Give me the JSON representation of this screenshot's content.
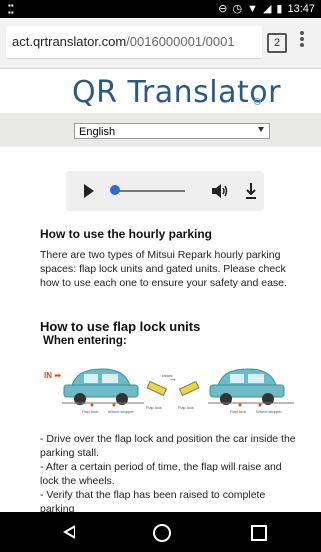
{
  "status_bar": {
    "time": "13:47",
    "left_icon": "notification-icon",
    "icons": [
      "minus-circle-icon",
      "alarm-icon",
      "wifi-icon",
      "signal-icon",
      "battery-icon"
    ]
  },
  "browser": {
    "url_domain": "act.qrtranslator.com",
    "url_path": "/0016000001/0001",
    "tab_count": "2"
  },
  "brand": {
    "logo_text": "QR Translator"
  },
  "language": {
    "selected": "English"
  },
  "content": {
    "hourly_title": "How to use the hourly parking",
    "hourly_text": "There are two types of Mitsui Repark hourly parking spaces: flap lock units and gated units. Please check how to use each one to ensure your safety and ease.",
    "flap_title": "How to use flap lock units",
    "entering_title": "When entering:",
    "in_label": "IN",
    "diagram_labels": {
      "raises": "raises",
      "flap_lock": "Flap lock",
      "wheel_stopper": "Wheel stopper"
    },
    "steps": [
      "-   Drive over the flap lock and position the car inside the parking stall.",
      "-   After a certain period of time, the flap will raise and lock the wheels.",
      "-   Verify that the flap has been raised to complete parking"
    ]
  },
  "colors": {
    "logo": "#2b5a86",
    "accent": "#2f6ad3",
    "in_arrow": "#e14b1b",
    "car": "#6dbbc6"
  }
}
